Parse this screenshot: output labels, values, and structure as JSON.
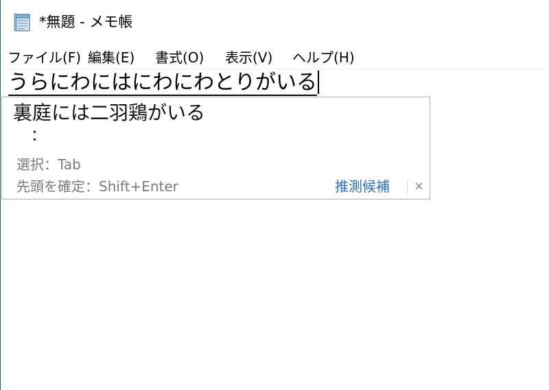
{
  "window": {
    "title": "*無題 - メモ帳",
    "icon": "notepad-icon"
  },
  "menu": {
    "items": [
      "ファイル(F)",
      "編集(E)",
      "書式(O)",
      "表示(V)",
      "ヘルプ(H)"
    ]
  },
  "editor": {
    "composition_text": "うらにわにはにわにわとりがいる"
  },
  "ime": {
    "candidate": "裏庭には二羽鶏がいる",
    "more": "：",
    "hint_select": "選択：Tab",
    "hint_confirm": "先頭を確定：Shift+Enter",
    "predict_label": "推測候補",
    "close_label": "×"
  },
  "colors": {
    "link": "#2b6fc9",
    "hint": "#7a7a7a",
    "window_border": "#2f5f7f"
  }
}
